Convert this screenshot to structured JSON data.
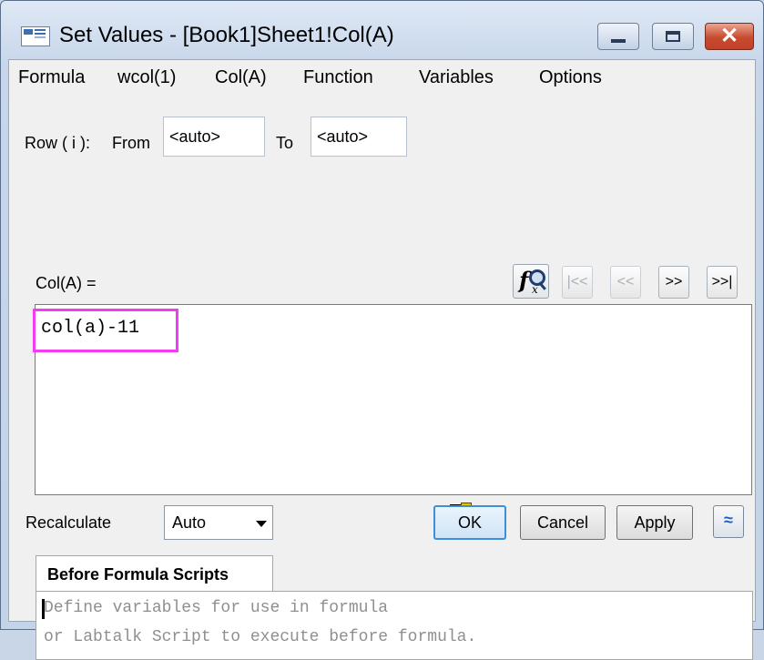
{
  "window": {
    "title": "Set Values - [Book1]Sheet1!Col(A)"
  },
  "menu": [
    "Formula",
    "wcol(1)",
    "Col(A)",
    "Function",
    "Variables",
    "Options"
  ],
  "row_range": {
    "label": "Row ( i ):",
    "from_label": "From",
    "from_value": "<auto>",
    "to_label": "To",
    "to_value": "<auto>"
  },
  "formula": {
    "label": "Col(A) =",
    "text": "col(a)-11",
    "nav_buttons": [
      "|<<",
      "<<",
      ">>",
      ">>|"
    ],
    "highlight_color": "#f23cf2"
  },
  "recalculate": {
    "label": "Recalculate",
    "selected": "Auto"
  },
  "buttons": {
    "ok": "OK",
    "cancel": "Cancel",
    "apply": "Apply",
    "collapse": "≈"
  },
  "scripts": {
    "tab_label": "Before Formula Scripts",
    "placeholder_line1": "Define variables for use in formula",
    "placeholder_line2": "or Labtalk Script to execute before formula."
  },
  "icons": [
    "app-icon",
    "minimize-icon",
    "maximize-icon",
    "close-icon",
    "function-search-icon",
    "copy-formula-icon",
    "collapse-icon"
  ]
}
